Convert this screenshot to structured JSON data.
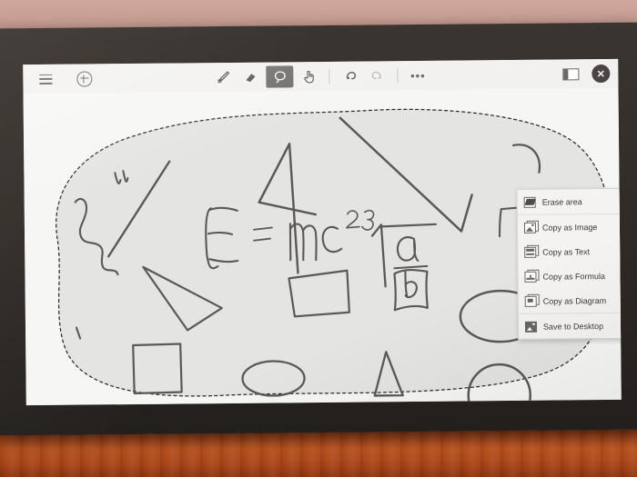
{
  "app": {
    "surface": "digital-whiteboard"
  },
  "toolbar": {
    "left": [
      {
        "name": "menu-icon",
        "label": "Menu"
      },
      {
        "name": "add-icon",
        "label": "Add"
      }
    ],
    "center": [
      {
        "name": "pen-icon",
        "label": "Pen",
        "selected": false,
        "disabled": false
      },
      {
        "name": "eraser-icon",
        "label": "Eraser",
        "selected": false,
        "disabled": false
      },
      {
        "name": "lasso-select-icon",
        "label": "Lasso select",
        "selected": true,
        "disabled": false
      },
      {
        "name": "hand-touch-icon",
        "label": "Touch",
        "selected": false,
        "disabled": false
      },
      {
        "name": "undo-icon",
        "label": "Undo",
        "selected": false,
        "disabled": false
      },
      {
        "name": "redo-icon",
        "label": "Redo",
        "selected": false,
        "disabled": true
      },
      {
        "name": "more-options-icon",
        "label": "More options",
        "selected": false,
        "disabled": false
      }
    ],
    "more_glyph": "•••",
    "right": [
      {
        "name": "panel-layout-icon",
        "label": "Panel"
      },
      {
        "name": "close-button",
        "label": "✕"
      }
    ]
  },
  "context_menu": {
    "items": [
      {
        "icon": "erase-area-icon",
        "label": "Erase area"
      },
      {
        "icon": "copy-as-image-icon",
        "label": "Copy as Image"
      },
      {
        "icon": "copy-as-text-icon",
        "label": "Copy as Text"
      },
      {
        "icon": "copy-as-formula-icon",
        "label": "Copy as Formula"
      },
      {
        "icon": "copy-as-diagram-icon",
        "label": "Copy as Diagram"
      },
      {
        "icon": "save-to-desktop-icon",
        "label": "Save to Desktop"
      }
    ]
  },
  "canvas": {
    "selection": {
      "active": true,
      "style": "lasso-dashed",
      "fill": "#e4e4e2",
      "stroke": "#2e2b29"
    },
    "ink_color": "#5b5855",
    "annotations": [
      {
        "name": "handwritten-formula",
        "text": "E = mc² ∛(a/b)"
      },
      {
        "name": "handwritten-scribble-left",
        "text": "w"
      },
      {
        "name": "handwritten-text-right",
        "text": "ПР"
      }
    ],
    "shapes": [
      "triangle",
      "square",
      "ellipse",
      "circle",
      "quadrilateral",
      "angular-strokes"
    ]
  },
  "colors": {
    "screen_bg": "#f6f6f4",
    "toolbar_bg": "#f2f1ef",
    "selection_highlight": "#6e6a67",
    "menu_bg": "#f4f3f1",
    "device_bezel": "#2f2a26",
    "desk": "#b3501e",
    "wall": "#c89c91"
  }
}
